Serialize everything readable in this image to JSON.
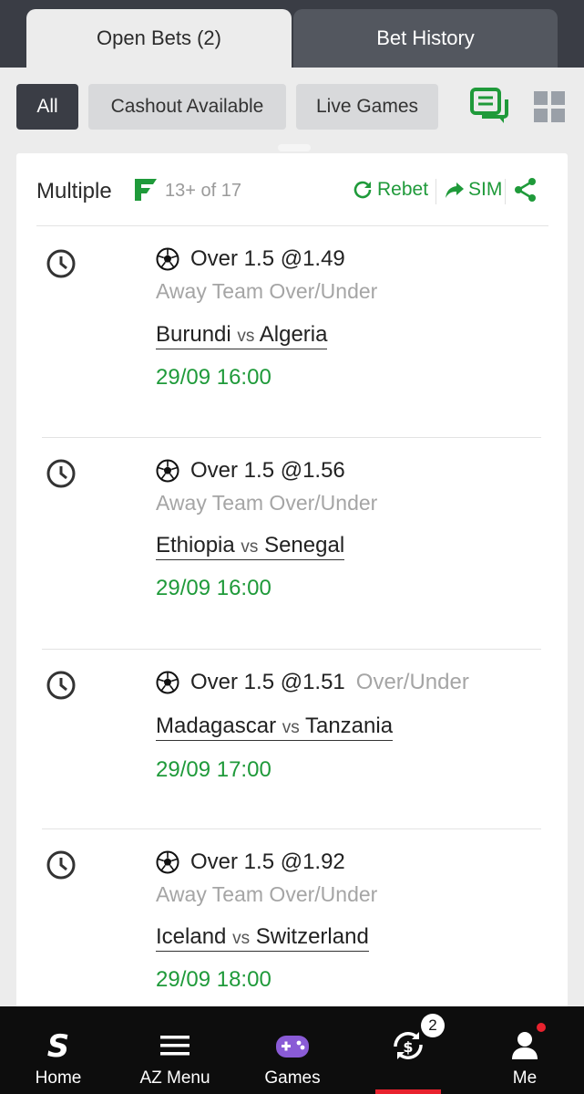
{
  "tabs": {
    "open_bets": "Open Bets (2)",
    "bet_history": "Bet History"
  },
  "filters": {
    "all": "All",
    "cashout": "Cashout Available",
    "live": "Live Games"
  },
  "colors": {
    "accent_green": "#1f9a3a",
    "dark": "#3a3d45",
    "red": "#e8222e"
  },
  "card": {
    "title": "Multiple",
    "legs_label": "13+ of 17",
    "rebet": "Rebet",
    "sim": "SIM"
  },
  "legs": [
    {
      "selection": "Over 1.5 @1.49",
      "market": "Away Team Over/Under",
      "home": "Burundi",
      "vs": "vs",
      "away": "Algeria",
      "time": "29/09 16:00"
    },
    {
      "selection": "Over 1.5 @1.56",
      "market": "Away Team Over/Under",
      "home": "Ethiopia",
      "vs": "vs",
      "away": "Senegal",
      "time": "29/09 16:00"
    },
    {
      "selection": "Over 1.5 @1.51",
      "market": "Over/Under",
      "home": "Madagascar",
      "vs": "vs",
      "away": "Tanzania",
      "time": "29/09 17:00"
    },
    {
      "selection": "Over 1.5 @1.92",
      "market": "Away Team Over/Under",
      "home": "Iceland",
      "vs": "vs",
      "away": "Switzerland",
      "time": "29/09 18:00"
    }
  ],
  "nav": {
    "home": "Home",
    "az_menu": "AZ Menu",
    "games": "Games",
    "bets_badge": "2",
    "me": "Me"
  },
  "icons": [
    "clock-icon",
    "football-icon",
    "refresh-icon",
    "share-arrow-icon",
    "share-icon",
    "chat-bets-icon",
    "grid-icon",
    "home-logo-icon",
    "menu-icon",
    "gamepad-icon",
    "mybets-icon",
    "user-icon"
  ]
}
